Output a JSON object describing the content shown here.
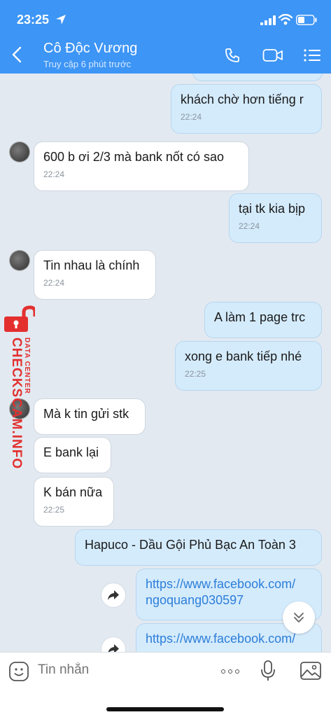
{
  "status_bar": {
    "time": "23:25"
  },
  "header": {
    "contact_name": "Cô Độc Vương",
    "last_seen": "Truy cập 6 phút trước"
  },
  "messages": [
    {
      "direction": "out",
      "text": "khách chờ hơn tiếng r",
      "time": "22:24"
    },
    {
      "direction": "in",
      "text": "600 b ơi 2/3 mà bank nốt có sao",
      "time": "22:24"
    },
    {
      "direction": "out",
      "text": "tại tk kia bịp",
      "time": "22:24"
    },
    {
      "direction": "in",
      "text": "Tin nhau là chính",
      "time": "22:24"
    },
    {
      "direction": "out",
      "text": "A làm 1 page trc"
    },
    {
      "direction": "out",
      "text": "xong e bank tiếp nhé",
      "time": "22:25"
    },
    {
      "direction": "in",
      "text": "Mà k tin gửi stk"
    },
    {
      "direction": "in",
      "text": "E bank lại"
    },
    {
      "direction": "in",
      "text": "K bán nữa",
      "time": "22:25"
    },
    {
      "direction": "out",
      "text": "Hapuco - Dầu Gội Phủ Bạc An Toàn 3"
    },
    {
      "direction": "out",
      "link_line1": "https://www.facebook.com/",
      "link_line2": "ngoquang030597"
    },
    {
      "direction": "out",
      "link_line1": "https://www.facebook.com/"
    }
  ],
  "watermark": {
    "site": "CHECKSCAM.INFO",
    "subtitle": "DATA CENTER"
  },
  "input_bar": {
    "placeholder": "Tin nhắn"
  },
  "colors": {
    "header_bg": "#3d95f5",
    "chat_bg": "#e2e9f1",
    "outgoing_bubble": "#d4ebfc",
    "incoming_bubble": "#ffffff",
    "link": "#2d7ed8",
    "watermark": "#e3302f"
  }
}
